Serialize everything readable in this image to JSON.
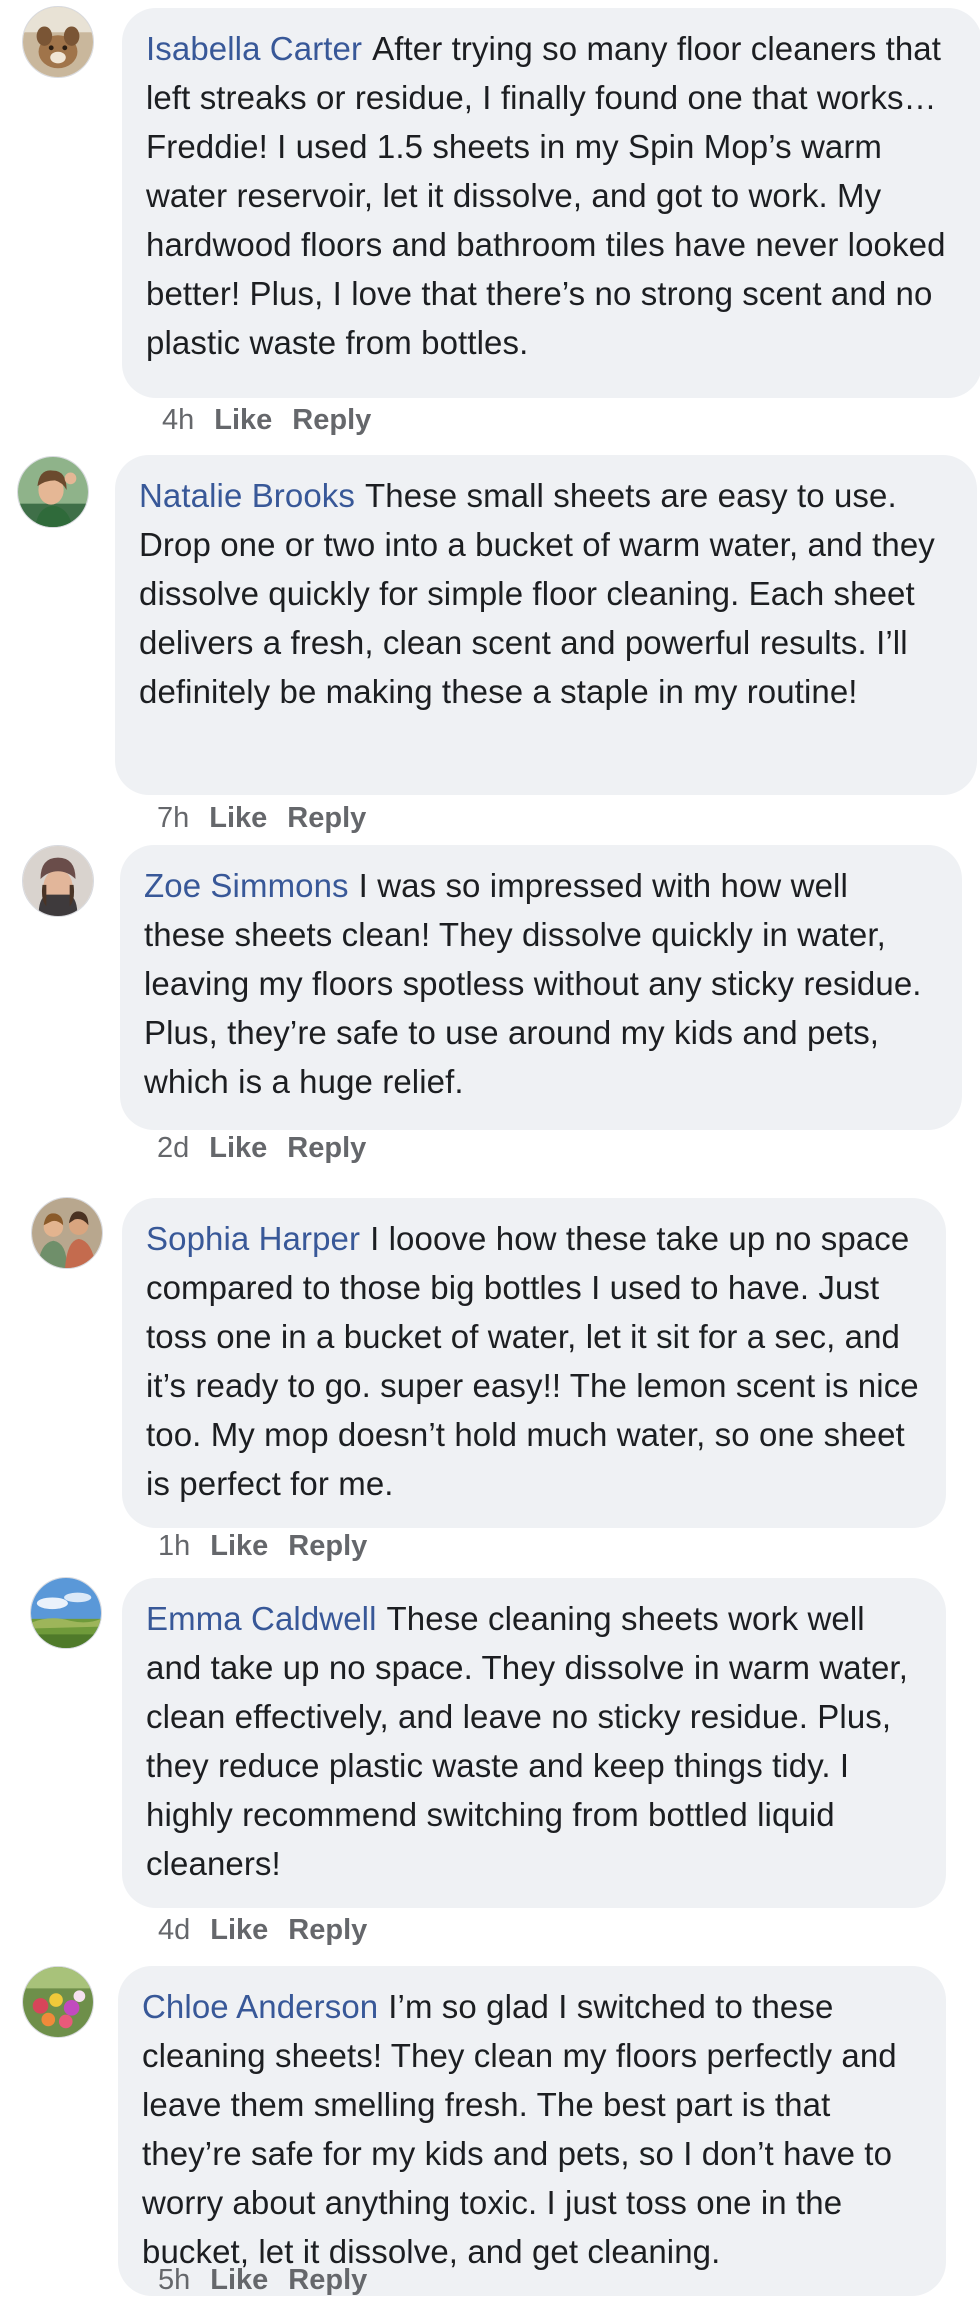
{
  "comments": [
    {
      "author": "Isabella Carter",
      "text": "After trying so many floor cleaners that left streaks or residue, I finally found one that works…Freddie! I used 1.5 sheets in my Spin Mop’s warm water reservoir, let it dissolve, and got to work. My hardwood floors and bathroom tiles have never looked better! Plus, I love that there’s no strong scent and no plastic waste from bottles.",
      "time": "4h",
      "like": "Like",
      "reply": "Reply"
    },
    {
      "author": "Natalie Brooks",
      "text": "These small sheets are easy to use. Drop one or two into a bucket of warm water, and they dissolve quickly for simple floor cleaning. Each sheet delivers a fresh, clean scent and powerful results. I’ll definitely be making these a staple in my routine!",
      "time": "7h",
      "like": "Like",
      "reply": "Reply"
    },
    {
      "author": "Zoe Simmons",
      "text": "I was so impressed with how well these sheets clean! They dissolve quickly in water, leaving my floors spotless without any sticky residue. Plus, they’re safe to use around my kids and pets, which is a huge relief.",
      "time": "2d",
      "like": "Like",
      "reply": "Reply"
    },
    {
      "author": "Sophia Harper",
      "text": "I looove how these take up no space compared to those big bottles I used to have. Just toss one in a bucket of water, let it sit for a sec, and it’s ready to go. super easy!! The lemon scent is nice too. My mop doesn’t hold much water, so one sheet is perfect for me.",
      "time": "1h",
      "like": "Like",
      "reply": "Reply"
    },
    {
      "author": "Emma Caldwell",
      "text": "These cleaning sheets work well and take up no space. They dissolve in warm water, clean effectively, and leave no sticky residue. Plus, they reduce plastic waste and keep things tidy. I highly recommend switching from bottled liquid cleaners!",
      "time": "4d",
      "like": "Like",
      "reply": "Reply"
    },
    {
      "author": "Chloe Anderson",
      "text": "I’m so glad I switched to these cleaning sheets! They clean my floors perfectly and leave them smelling fresh. The best part is that they’re safe for my kids and pets, so I don’t have to worry about anything toxic. I just toss one in the bucket, let it dissolve, and get cleaning.",
      "time": "5h",
      "like": "Like",
      "reply": "Reply"
    }
  ],
  "colors": {
    "author_link": "#385898",
    "bubble_background": "#eff1f4",
    "meta_text": "#65676b"
  }
}
